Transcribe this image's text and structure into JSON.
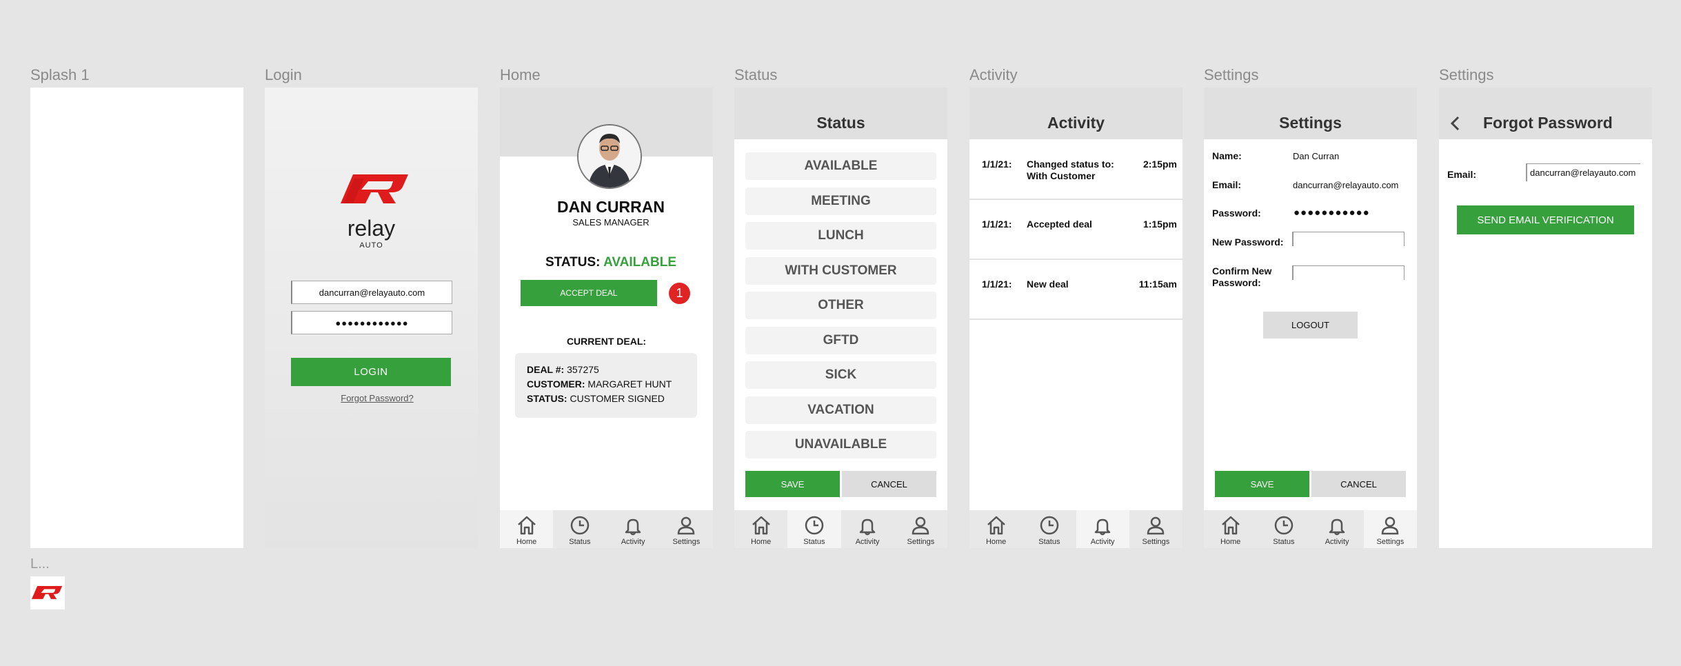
{
  "frames": {
    "splash": {
      "label": "Splash 1"
    },
    "login": {
      "label": "Login"
    },
    "home": {
      "label": "Home"
    },
    "status": {
      "label": "Status"
    },
    "activity": {
      "label": "Activity"
    },
    "settings": {
      "label": "Settings"
    },
    "forgot": {
      "label": "Settings"
    },
    "logo_asset": {
      "label": "L..."
    }
  },
  "brand": {
    "name": "relay",
    "sub": "AUTO",
    "color": "#e01b1b",
    "green": "#36a03d"
  },
  "login": {
    "email": "dancurran@relayauto.com",
    "password": "●●●●●●●●●●●●",
    "button": "LOGIN",
    "forgot": "Forgot Password?"
  },
  "home": {
    "name": "DAN CURRAN",
    "role": "SALES MANAGER",
    "status_label": "STATUS:",
    "status_value": "AVAILABLE",
    "accept_button": "ACCEPT DEAL",
    "badge": "1",
    "current_deal_title": "CURRENT DEAL:",
    "deal": {
      "deal_label": "DEAL #:",
      "deal_value": "357275",
      "customer_label": "CUSTOMER:",
      "customer_value": "MARGARET HUNT",
      "status_label": "STATUS:",
      "status_value": "CUSTOMER SIGNED"
    }
  },
  "status": {
    "title": "Status",
    "options": [
      "AVAILABLE",
      "MEETING",
      "LUNCH",
      "WITH CUSTOMER",
      "OTHER",
      "GFTD",
      "SICK",
      "VACATION",
      "UNAVAILABLE"
    ],
    "save": "SAVE",
    "cancel": "CANCEL"
  },
  "activity": {
    "title": "Activity",
    "rows": [
      {
        "date": "1/1/21:",
        "text": "Changed status to: With Customer",
        "time": "2:15pm"
      },
      {
        "date": "1/1/21:",
        "text": "Accepted deal",
        "time": "1:15pm"
      },
      {
        "date": "1/1/21:",
        "text": "New deal",
        "time": "11:15am"
      }
    ]
  },
  "settings": {
    "title": "Settings",
    "name_label": "Name:",
    "name_value": "Dan Curran",
    "email_label": "Email:",
    "email_value": "dancurran@relayauto.com",
    "password_label": "Password:",
    "password_value": "●●●●●●●●●●●",
    "new_password_label": "New Password:",
    "confirm_label": "Confirm New Password:",
    "logout": "LOGOUT",
    "save": "SAVE",
    "cancel": "CANCEL"
  },
  "forgot": {
    "title": "Forgot Password",
    "email_label": "Email:",
    "email_value": "dancurran@relayauto.com",
    "send_button": "SEND EMAIL VERIFICATION"
  },
  "tabs": [
    "Home",
    "Status",
    "Activity",
    "Settings"
  ],
  "icons": {
    "home": "home-icon",
    "status": "clock-icon",
    "activity": "bell-icon",
    "settings": "person-icon",
    "back": "chevron-left-icon"
  }
}
